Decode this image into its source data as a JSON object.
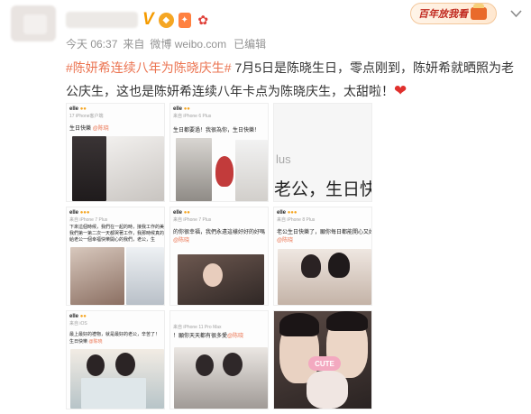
{
  "post": {
    "time": "今天 06:37",
    "source_prefix": "来自",
    "source": "微博 weibo.com",
    "edited": "已编辑",
    "topic": "#陈妍希连续八年为陈晓庆生#",
    "text": " 7月5日是陈晓生日，零点刚到，陈妍希就晒照为老公庆生，这也是陈妍希连续八年卡点为陈晓庆生，太甜啦！"
  },
  "header": {
    "verified_badge": "V",
    "brand_badge_text": "百年放我看"
  },
  "images": [
    {
      "head": "elle",
      "sub": "17 iPhone客户端",
      "line1": "生日快樂",
      "link": "@陈晓"
    },
    {
      "head": "elle",
      "sub": "来自 iPhone 6 Plus",
      "line1": "生日都要過！我很為你，生日快樂！",
      "link": ""
    },
    {
      "head": "",
      "sub": "",
      "line1": "lus",
      "line2": "老公，生日快樂"
    },
    {
      "head": "elle",
      "sub": "来自 iPhone 7 Plus",
      "line1": "下來這個時候，我們在一起的時，接我工作的美好",
      "line2": "我們第一第二次一天都哭著工作，我那時候真的",
      "line3": "給老公一個幸福快樂開心的我們，老公，生",
      "link": ""
    },
    {
      "head": "elle",
      "sub": "来自 iPhone 7 Plus",
      "line1": "的你很幸福，我們永遠這樣好好的好嗎",
      "link": "@陈晓"
    },
    {
      "head": "elle",
      "sub": "来自 iPhone 8 Plus",
      "line1": "老公生日快樂了，願你每日都能開心又好",
      "link": "@陈晓"
    },
    {
      "head": "elle",
      "sub": "来自 iOS",
      "line1": "最上最好的禮物，就是最好的老公，辛苦了！",
      "line2": "生日快樂",
      "link": "@陈晓"
    },
    {
      "head": "",
      "sub": "来自 iPhone 11 Pro Max",
      "line1": "！願你天天都有很多愛",
      "link": "@陈晓"
    },
    {
      "sticker": "CUTE"
    }
  ],
  "colors": {
    "topic": "#eb7350",
    "meta": "#939393",
    "verified": "#f59b00",
    "heart": "#e0302d"
  },
  "icons": {
    "more": "chevron-down-icon",
    "heart": "heart-icon",
    "verified": "verified-v-icon"
  }
}
